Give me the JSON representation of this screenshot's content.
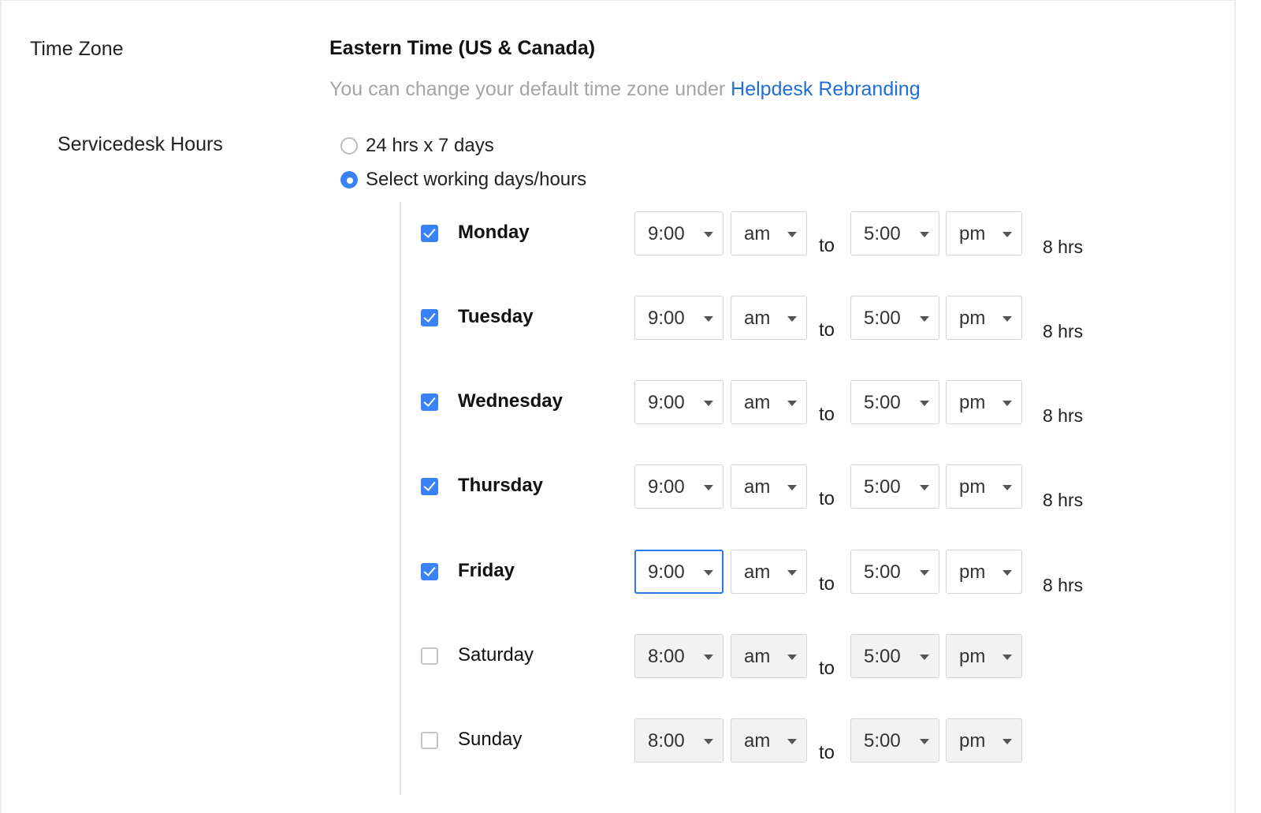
{
  "time_zone": {
    "label": "Time Zone",
    "value": "Eastern Time (US & Canada)",
    "hint": "You can change your default time zone under",
    "link": "Helpdesk Rebranding"
  },
  "servicedesk": {
    "label": "Servicedesk Hours",
    "options": [
      {
        "label": "24 hrs x 7 days",
        "selected": false
      },
      {
        "label": "Select working days/hours",
        "selected": true
      }
    ],
    "to_label": "to",
    "days": [
      {
        "name": "Monday",
        "checked": true,
        "start": "9:00",
        "start_ampm": "am",
        "end": "5:00",
        "end_ampm": "pm",
        "hours": "8 hrs",
        "focused": false
      },
      {
        "name": "Tuesday",
        "checked": true,
        "start": "9:00",
        "start_ampm": "am",
        "end": "5:00",
        "end_ampm": "pm",
        "hours": "8 hrs",
        "focused": false
      },
      {
        "name": "Wednesday",
        "checked": true,
        "start": "9:00",
        "start_ampm": "am",
        "end": "5:00",
        "end_ampm": "pm",
        "hours": "8 hrs",
        "focused": false
      },
      {
        "name": "Thursday",
        "checked": true,
        "start": "9:00",
        "start_ampm": "am",
        "end": "5:00",
        "end_ampm": "pm",
        "hours": "8 hrs",
        "focused": false
      },
      {
        "name": "Friday",
        "checked": true,
        "start": "9:00",
        "start_ampm": "am",
        "end": "5:00",
        "end_ampm": "pm",
        "hours": "8 hrs",
        "focused": true
      },
      {
        "name": "Saturday",
        "checked": false,
        "start": "8:00",
        "start_ampm": "am",
        "end": "5:00",
        "end_ampm": "pm",
        "hours": "",
        "focused": false
      },
      {
        "name": "Sunday",
        "checked": false,
        "start": "8:00",
        "start_ampm": "am",
        "end": "5:00",
        "end_ampm": "pm",
        "hours": "",
        "focused": false
      }
    ]
  },
  "colors": {
    "accent": "#3a82f7",
    "link": "#1f6fd6",
    "hint_text": "#a5a5a5",
    "disabled_select_bg": "#f2f2f2"
  }
}
